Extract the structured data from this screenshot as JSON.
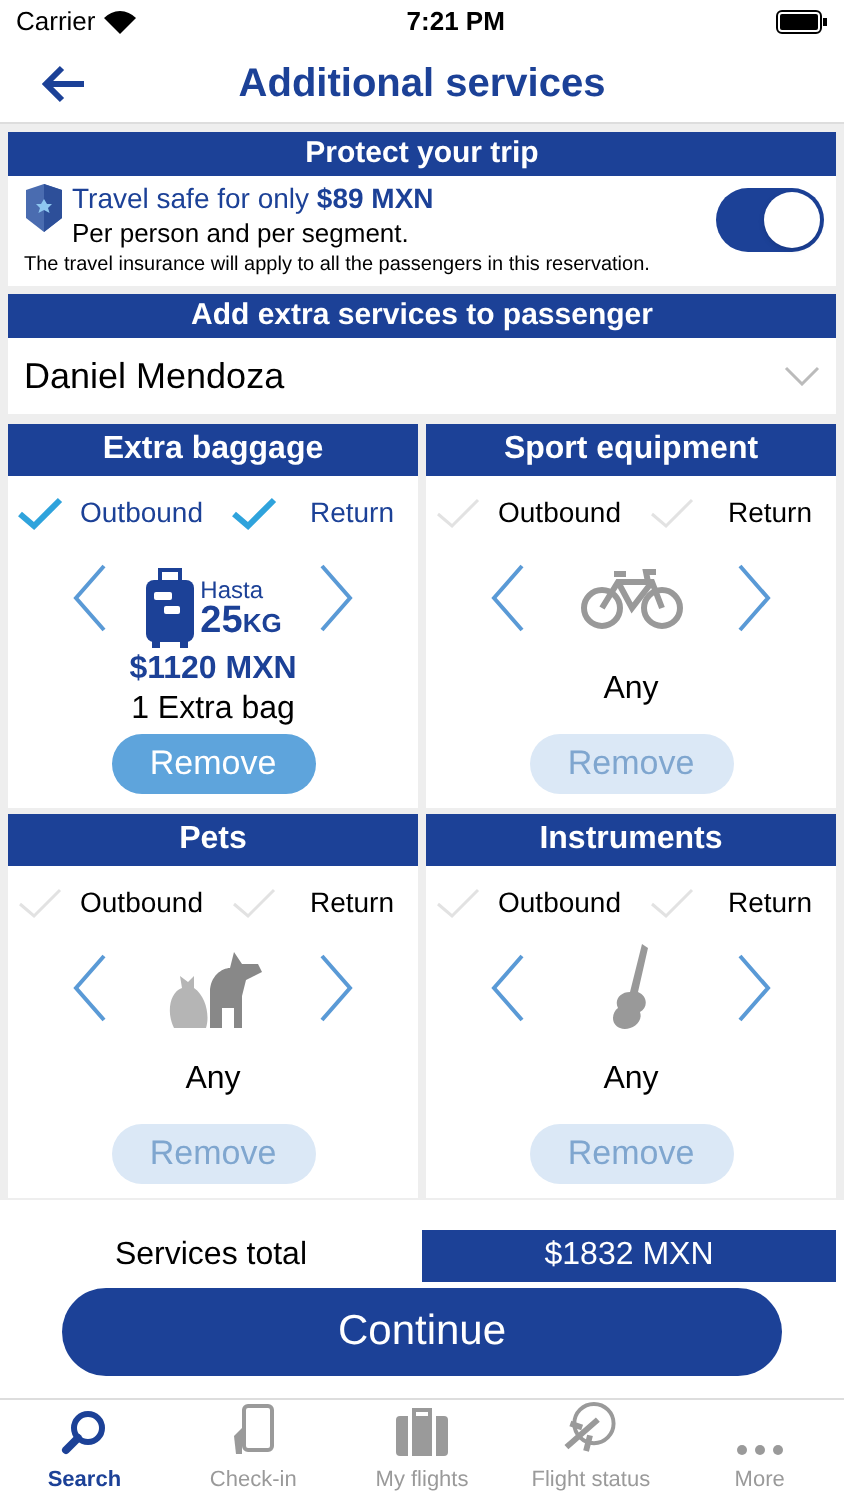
{
  "status_bar": {
    "carrier": "Carrier",
    "time": "7:21 PM"
  },
  "nav": {
    "title": "Additional services"
  },
  "insurance": {
    "header": "Protect your trip",
    "offer": "Travel safe for only **$89 MXN**",
    "subtitle": "Per person and per segment.",
    "note": "The travel insurance will apply to all the passengers in this reservation.",
    "on": true
  },
  "passenger": {
    "header": "Add extra services to passenger",
    "name": "Daniel Mendoza"
  },
  "services": [
    {
      "title": "Extra baggage",
      "kind": "baggage",
      "outbound": {
        "label": "Outbound",
        "checked": true
      },
      "return": {
        "label": "Return",
        "checked": true
      },
      "badge_top": "Hasta",
      "badge_weight": "25",
      "badge_unit": "KG",
      "price": "$1120 MXN",
      "detail": "1 Extra bag",
      "remove": {
        "label": "Remove",
        "disabled": false
      }
    },
    {
      "title": "Sport equipment",
      "kind": "bike",
      "outbound": {
        "label": "Outbound",
        "checked": false
      },
      "return": {
        "label": "Return",
        "checked": false
      },
      "detail": "Any",
      "remove": {
        "label": "Remove",
        "disabled": true
      }
    },
    {
      "title": "Pets",
      "kind": "pets",
      "outbound": {
        "label": "Outbound",
        "checked": false
      },
      "return": {
        "label": "Return",
        "checked": false
      },
      "detail": "Any",
      "remove": {
        "label": "Remove",
        "disabled": true
      }
    },
    {
      "title": "Instruments",
      "kind": "guitar",
      "outbound": {
        "label": "Outbound",
        "checked": false
      },
      "return": {
        "label": "Return",
        "checked": false
      },
      "detail": "Any",
      "remove": {
        "label": "Remove",
        "disabled": true
      }
    }
  ],
  "total": {
    "label": "Services total",
    "value": "$1832 MXN"
  },
  "continue_button": "Continue",
  "tab_bar": [
    {
      "label": "Search",
      "kind": "search",
      "selected": true
    },
    {
      "label": "Check-in",
      "kind": "phone",
      "selected": false
    },
    {
      "label": "My flights",
      "kind": "suitcase",
      "selected": false
    },
    {
      "label": "Flight status",
      "kind": "status",
      "selected": false
    },
    {
      "label": "More",
      "kind": "more",
      "selected": false
    }
  ]
}
